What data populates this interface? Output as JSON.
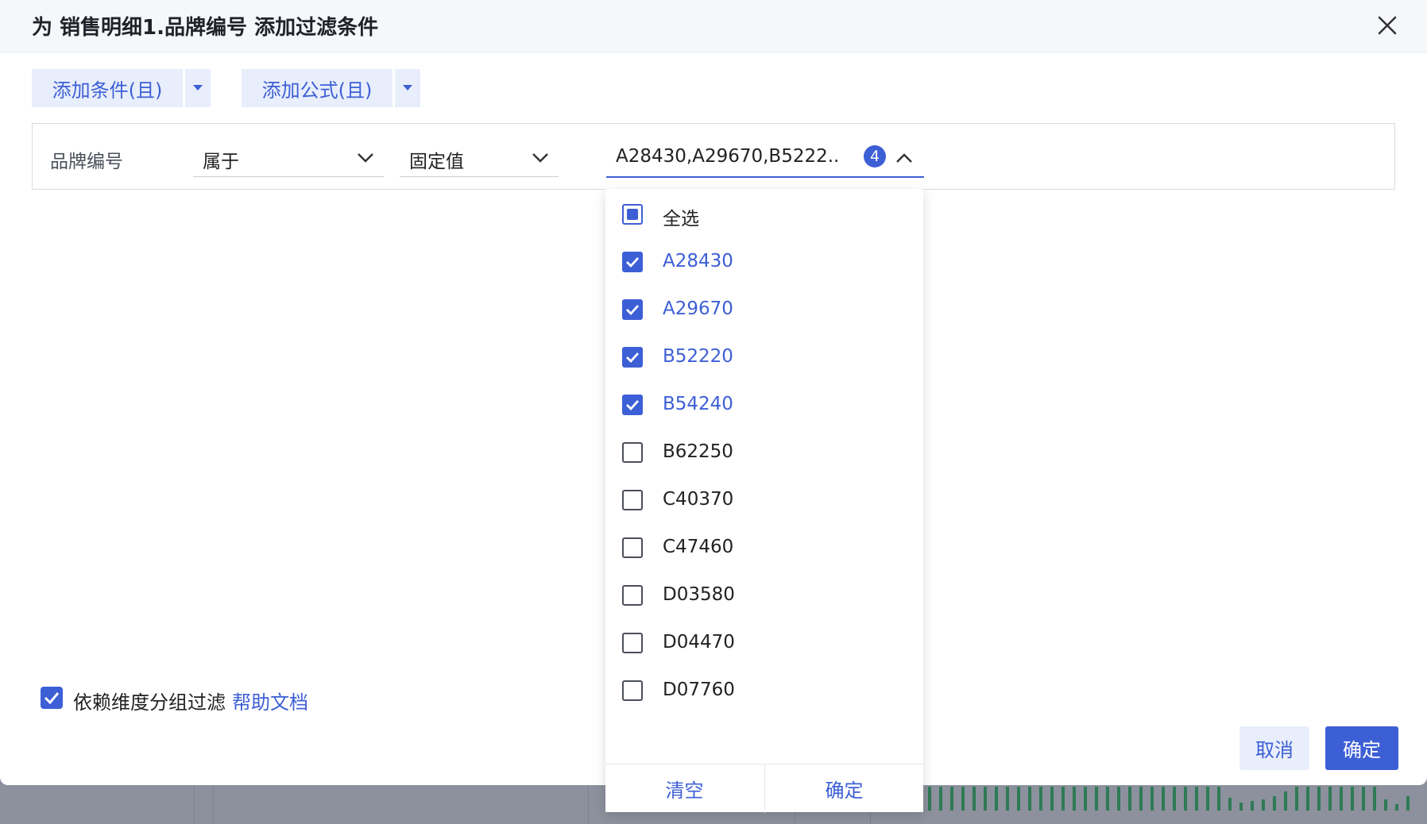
{
  "dialog": {
    "title": "为 销售明细1.品牌编号 添加过滤条件"
  },
  "toolbar": {
    "add_condition_label": "添加条件(且)",
    "add_formula_label": "添加公式(且)"
  },
  "condition": {
    "field_label": "品牌编号",
    "operator_value": "属于",
    "value_type": "固定值",
    "selected_summary": "A28430,A29670,B5222...",
    "selected_count": "4"
  },
  "dropdown": {
    "select_all_label": "全选",
    "options": [
      {
        "label": "A28430",
        "checked": true
      },
      {
        "label": "A29670",
        "checked": true
      },
      {
        "label": "B52220",
        "checked": true
      },
      {
        "label": "B54240",
        "checked": true
      },
      {
        "label": "B62250",
        "checked": false
      },
      {
        "label": "C40370",
        "checked": false
      },
      {
        "label": "C47460",
        "checked": false
      },
      {
        "label": "D03580",
        "checked": false
      },
      {
        "label": "D04470",
        "checked": false
      },
      {
        "label": "D07760",
        "checked": false
      }
    ],
    "clear_label": "清空",
    "confirm_label": "确定"
  },
  "footer": {
    "dependency_label": "依赖维度分组过滤",
    "help_link": "帮助文档",
    "cancel_label": "取消",
    "ok_label": "确定"
  },
  "colors": {
    "accent": "#3d5fd6",
    "accent_light": "#e8eefb",
    "header_bg": "#f5f7fb",
    "overlay": "#8a8f9c"
  }
}
